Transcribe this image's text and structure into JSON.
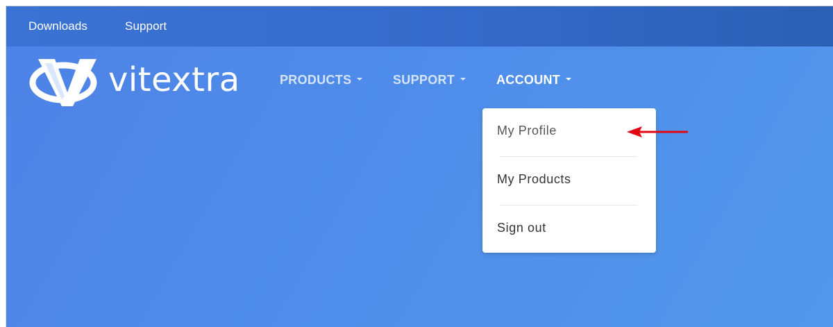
{
  "topbar": {
    "links": [
      {
        "label": "Downloads"
      },
      {
        "label": "Support"
      }
    ]
  },
  "logo": {
    "text": "vitextra"
  },
  "nav": {
    "items": [
      {
        "label": "PRODUCTS"
      },
      {
        "label": "SUPPORT"
      },
      {
        "label": "ACCOUNT"
      }
    ]
  },
  "dropdown": {
    "items": [
      {
        "label": "My Profile"
      },
      {
        "label": "My Products"
      },
      {
        "label": "Sign out"
      }
    ]
  },
  "colors": {
    "topbar": "#3469c8",
    "background": "#4f8fea",
    "annotation_arrow": "#e30613"
  }
}
